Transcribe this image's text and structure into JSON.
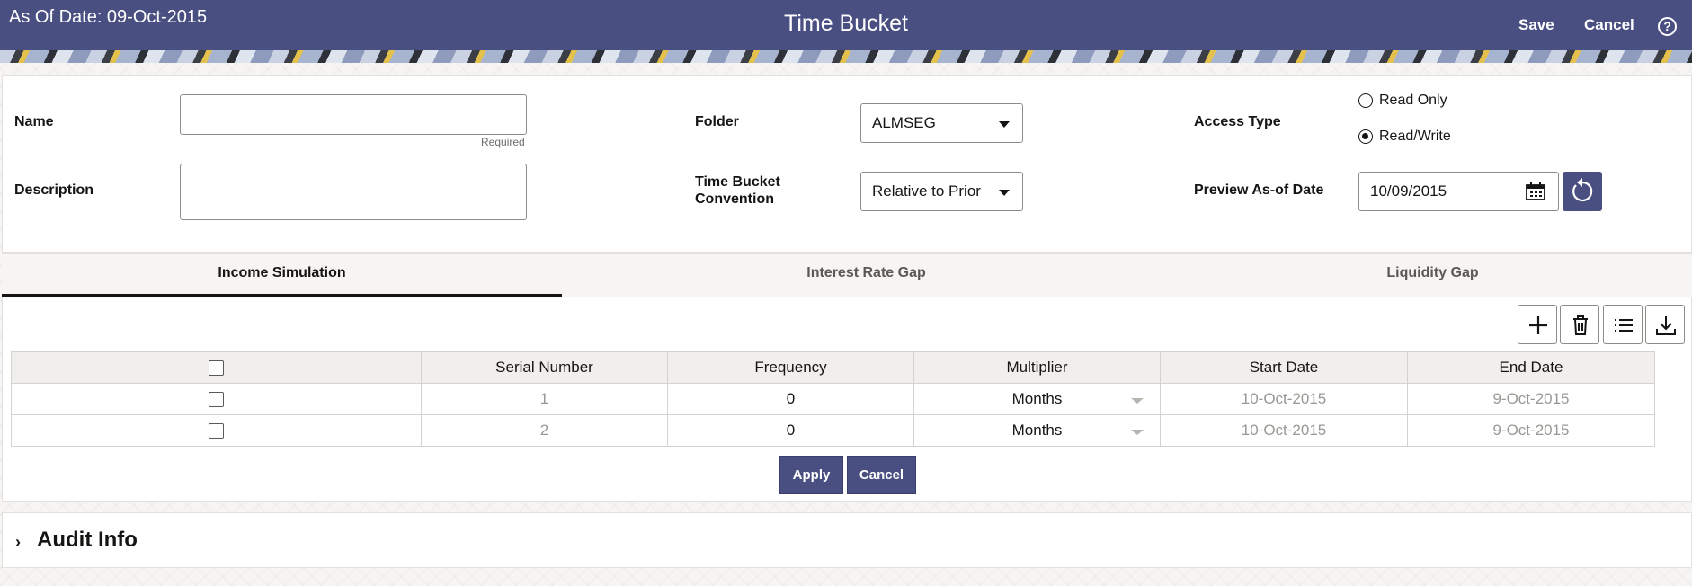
{
  "header": {
    "as_of": "As Of Date: 09-Oct-2015",
    "title": "Time Bucket",
    "save_label": "Save",
    "cancel_label": "Cancel",
    "help_glyph": "?"
  },
  "form": {
    "name_label": "Name",
    "name_value": "",
    "required_hint": "Required",
    "description_label": "Description",
    "description_value": "",
    "folder_label": "Folder",
    "folder_value": "ALMSEG",
    "convention_label_line1": "Time Bucket",
    "convention_label_line2": "Convention",
    "convention_value": "Relative to Prior",
    "access_type_label": "Access Type",
    "access_options": [
      {
        "label": "Read Only",
        "selected": false
      },
      {
        "label": "Read/Write",
        "selected": true
      }
    ],
    "preview_label": "Preview As-of Date",
    "preview_value": "10/09/2015"
  },
  "tabs": [
    {
      "label": "Income Simulation",
      "active": true
    },
    {
      "label": "Interest Rate Gap",
      "active": false
    },
    {
      "label": "Liquidity Gap",
      "active": false
    }
  ],
  "grid": {
    "columns": [
      "",
      "Serial Number",
      "Frequency",
      "Multiplier",
      "Start Date",
      "End Date"
    ],
    "rows": [
      {
        "serial": "1",
        "frequency": "0",
        "multiplier": "Months",
        "start": "10-Oct-2015",
        "end": "9-Oct-2015"
      },
      {
        "serial": "2",
        "frequency": "0",
        "multiplier": "Months",
        "start": "10-Oct-2015",
        "end": "9-Oct-2015"
      }
    ],
    "apply_label": "Apply",
    "cancel_label": "Cancel"
  },
  "audit": {
    "chevron": "›",
    "title": "Audit Info"
  },
  "colors": {
    "header": "#4a4f82",
    "button": "#4a4f82"
  },
  "icons": [
    "help-icon",
    "caret-down-icon",
    "calendar-icon",
    "refresh-icon",
    "add-icon",
    "delete-icon",
    "list-icon",
    "download-icon",
    "chevron-right-icon"
  ]
}
